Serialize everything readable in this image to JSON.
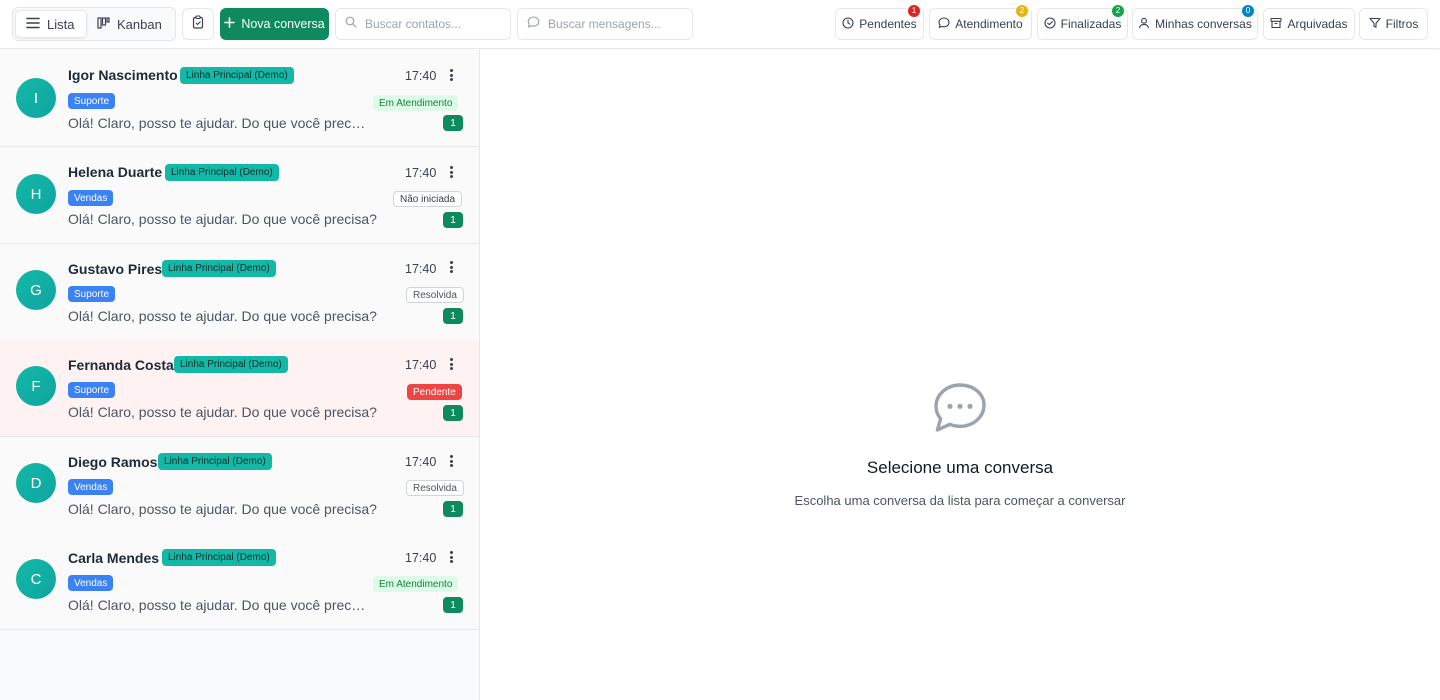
{
  "toolbar": {
    "view_list_label": "Lista",
    "view_kanban_label": "Kanban",
    "new_conversation_label": "Nova conversa",
    "search_contacts_placeholder": "Buscar contatos...",
    "search_messages_placeholder": "Buscar mensagens...",
    "filters": [
      {
        "label": "Pendentes",
        "count": "1",
        "badge_color": "#dc2626",
        "icon": "clock-icon"
      },
      {
        "label": "Atendimento",
        "count": "2",
        "badge_color": "#eab308",
        "icon": "chat-bubble-icon"
      },
      {
        "label": "Finalizadas",
        "count": "2",
        "badge_color": "#16a34a",
        "icon": "check-circle-icon"
      },
      {
        "label": "Minhas conversas",
        "count": "0",
        "badge_color": "#0284c7",
        "icon": "user-icon"
      },
      {
        "label": "Arquivadas",
        "icon": "archive-icon"
      },
      {
        "label": "Filtros",
        "icon": "funnel-icon"
      }
    ]
  },
  "conversations": [
    {
      "initial": "I",
      "name": "Igor Nascimento",
      "line": "Linha Principal (Demo)",
      "time": "17:40",
      "department": "Suporte",
      "status": "Em Atendimento",
      "status_kind": "em",
      "preview": "Olá! Claro, posso te ajudar. Do que você precisa?",
      "unread": "1"
    },
    {
      "initial": "H",
      "name": "Helena Duarte",
      "line": "Linha Principal (Demo)",
      "time": "17:40",
      "department": "Vendas",
      "status": "Não iniciada",
      "status_kind": "nao",
      "preview": "Olá! Claro, posso te ajudar. Do que você precisa?",
      "unread": "1"
    },
    {
      "initial": "G",
      "name": "Gustavo Pires",
      "line": "Linha Principal (Demo)",
      "time": "17:40",
      "department": "Suporte",
      "status": "Resolvida",
      "status_kind": "res",
      "preview": "Olá! Claro, posso te ajudar. Do que você precisa?",
      "unread": "1"
    },
    {
      "initial": "F",
      "name": "Fernanda Costa",
      "line": "Linha Principal (Demo)",
      "time": "17:40",
      "department": "Suporte",
      "status": "Pendente",
      "status_kind": "pen",
      "preview": "Olá! Claro, posso te ajudar. Do que você precisa?",
      "unread": "1"
    },
    {
      "initial": "D",
      "name": "Diego Ramos",
      "line": "Linha Principal (Demo)",
      "time": "17:40",
      "department": "Vendas",
      "status": "Resolvida",
      "status_kind": "res",
      "preview": "Olá! Claro, posso te ajudar. Do que você precisa?",
      "unread": "1"
    },
    {
      "initial": "C",
      "name": "Carla Mendes",
      "line": "Linha Principal (Demo)",
      "time": "17:40",
      "department": "Vendas",
      "status": "Em Atendimento",
      "status_kind": "em",
      "preview": "Olá! Claro, posso te ajudar. Do que você precisa?",
      "unread": "1"
    }
  ],
  "empty_state": {
    "title": "Selecione uma conversa",
    "subtitle": "Escolha uma conversa da lista para começar a conversar",
    "icon": "chat-bubble-dots-icon"
  }
}
